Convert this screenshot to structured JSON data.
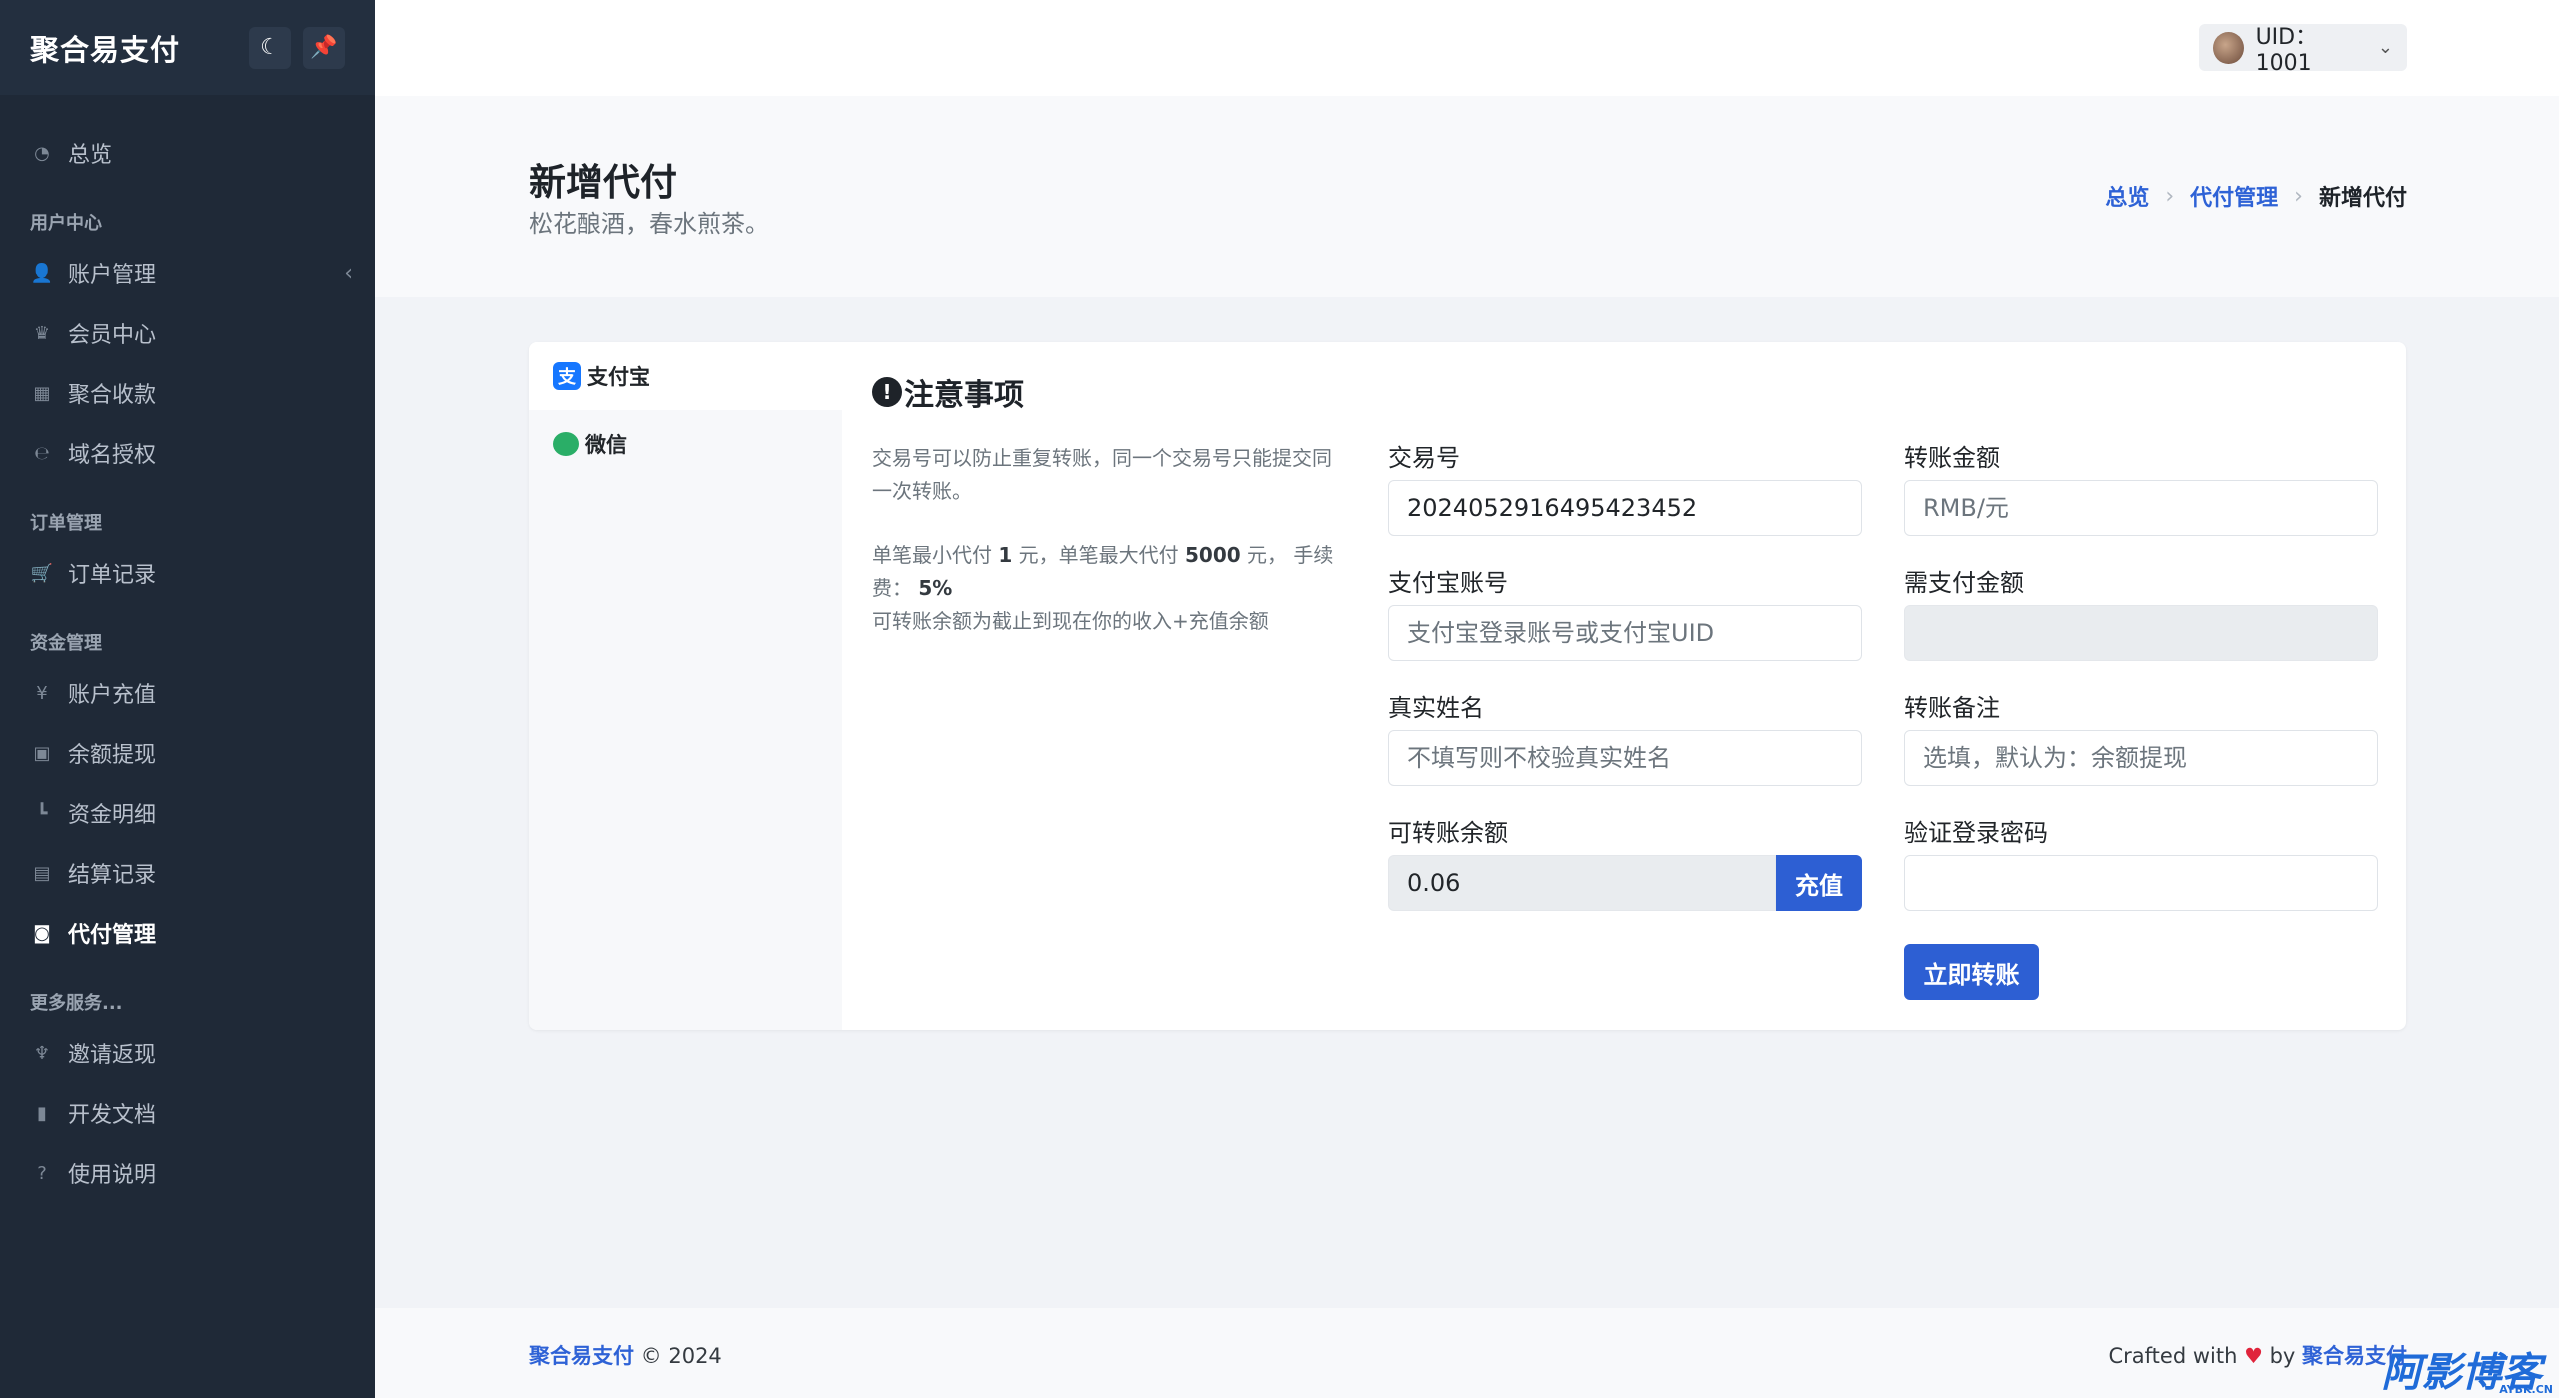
{
  "sidebar": {
    "brand": "聚合易支付",
    "theme_toggle": "☾",
    "pin": "📌",
    "items": [
      {
        "label": "总览",
        "icon": "◔"
      },
      {
        "section": "用户中心"
      },
      {
        "label": "账户管理",
        "icon": "👤",
        "caret": "‹"
      },
      {
        "label": "会员中心",
        "icon": "♛"
      },
      {
        "label": "聚合收款",
        "icon": "▦"
      },
      {
        "label": "域名授权",
        "icon": "℮"
      },
      {
        "section": "订单管理"
      },
      {
        "label": "订单记录",
        "icon": "🛒"
      },
      {
        "section": "资金管理"
      },
      {
        "label": "账户充值",
        "icon": "¥"
      },
      {
        "label": "余额提现",
        "icon": "▣"
      },
      {
        "label": "资金明细",
        "icon": "┗"
      },
      {
        "label": "结算记录",
        "icon": "▤"
      },
      {
        "label": "代付管理",
        "icon": "◙",
        "active": true
      },
      {
        "section": "更多服务..."
      },
      {
        "label": "邀请返现",
        "icon": "♆"
      },
      {
        "label": "开发文档",
        "icon": "▮"
      },
      {
        "label": "使用说明",
        "icon": "?"
      }
    ]
  },
  "header": {
    "user_label": "UID：1001",
    "caret": "⌄"
  },
  "hero": {
    "title": "新增代付",
    "subtitle": "松花酿酒，春水煎茶。",
    "breadcrumb": [
      "总览",
      "代付管理",
      "新增代付"
    ],
    "sep": "›"
  },
  "tabs": [
    {
      "label": "支付宝",
      "icon": "支"
    },
    {
      "label": "微信",
      "icon": "●"
    }
  ],
  "notice": {
    "icon": "!",
    "title": "注意事项",
    "line1": "交易号可以防止重复转账，同一个交易号只能提交同一次转账。",
    "line2_a": "单笔最小代付 ",
    "min": "1",
    "line2_b": " 元，单笔最大代付 ",
    "max": "5000",
    "line2_c": " 元， 手续费： ",
    "fee": "5%",
    "line3": "可转账余额为截止到现在你的收入+充值余额"
  },
  "form": {
    "trade_no_label": "交易号",
    "trade_no_value": "2024052916495423452",
    "amount_label": "转账金额",
    "amount_placeholder": "RMB/元",
    "account_label": "支付宝账号",
    "account_placeholder": "支付宝登录账号或支付宝UID",
    "need_pay_label": "需支付金额",
    "name_label": "真实姓名",
    "name_placeholder": "不填写则不校验真实姓名",
    "remark_label": "转账备注",
    "remark_placeholder": "选填，默认为：余额提现",
    "balance_label": "可转账余额",
    "balance_value": "0.06",
    "recharge_label": "充值",
    "password_label": "验证登录密码",
    "submit_label": "立即转账"
  },
  "footer": {
    "brand": "聚合易支付",
    "copyright": " © 2024",
    "crafted": "Crafted with ",
    "heart": "♥",
    "by": " by ",
    "brand2": "聚合易支付"
  },
  "watermark": {
    "main": "阿影博客",
    "sub": "AYBK.CN"
  }
}
